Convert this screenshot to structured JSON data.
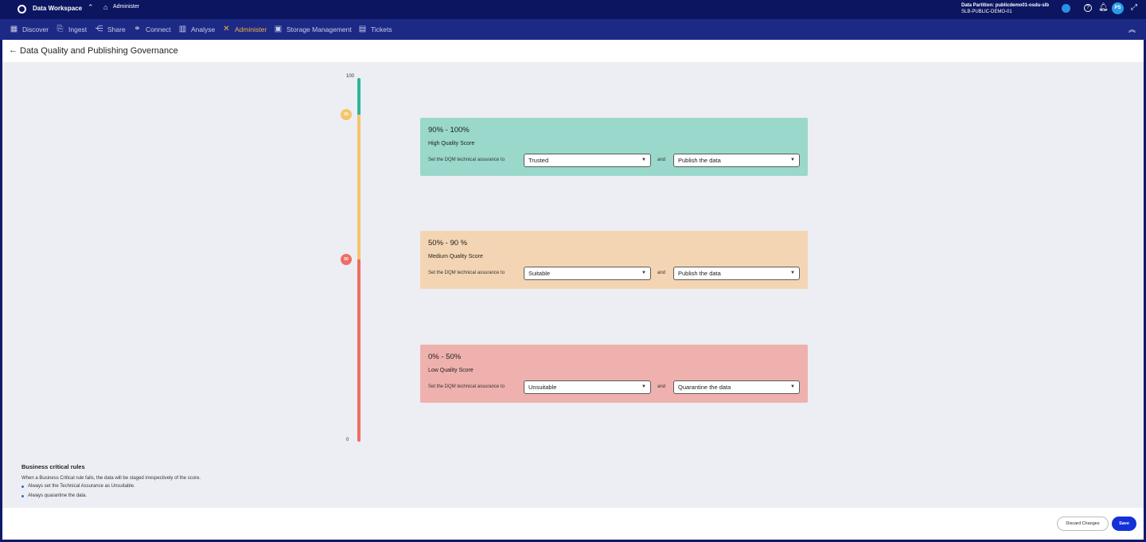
{
  "topbar": {
    "app_title": "Data Workspace",
    "breadcrumb": "Administer",
    "partition_label": "Data Partition: publicdemo01-osdu-slb",
    "partition_sub": "SLB-PUBLIC-DEMO-01",
    "avatar_initials": "PS",
    "help_glyph": "?"
  },
  "nav": {
    "items": [
      {
        "label": "Discover",
        "icon": "grid-icon"
      },
      {
        "label": "Ingest",
        "icon": "ingest-icon"
      },
      {
        "label": "Share",
        "icon": "share-icon"
      },
      {
        "label": "Connect",
        "icon": "connect-icon"
      },
      {
        "label": "Analyse",
        "icon": "analyse-icon"
      },
      {
        "label": "Administer",
        "icon": "administer-icon",
        "active": true
      },
      {
        "label": "Storage Management",
        "icon": "storage-icon"
      },
      {
        "label": "Tickets",
        "icon": "tickets-icon"
      }
    ],
    "active_color": "#f4b33c"
  },
  "page": {
    "title": "Data Quality and Publishing Governance"
  },
  "scale": {
    "top_label": "100",
    "bottom_label": "0",
    "marker_high": "90",
    "marker_med": "50",
    "colors": {
      "high": "#2db59a",
      "medium": "#f6c56a",
      "low": "#ef6d63"
    }
  },
  "cards": {
    "high": {
      "range": "90% - 100%",
      "label": "High Quality Score",
      "set_label": "Set the DQM technical assurance to",
      "assurance": "Trusted",
      "and": "and",
      "action": "Publish the data"
    },
    "medium": {
      "range": "50% - 90 %",
      "label": "Medium Quality Score",
      "set_label": "Set the DQM technical assurance to",
      "assurance": "Suitable",
      "and": "and",
      "action": "Publish the data"
    },
    "low": {
      "range": "0% - 50%",
      "label": "Low Quality Score",
      "set_label": "Set the DQM technical assurance to",
      "assurance": "Unsuitable",
      "and": "and",
      "action": "Quarantine the data"
    }
  },
  "rules": {
    "title": "Business critical rules",
    "description": "When a Business Critical rule fails, the data will be staged irrespectively of the score.",
    "items": [
      "Always set the Technical Assurance as Unsuitable.",
      "Always quarantine the data."
    ]
  },
  "footer": {
    "discard_label": "Discard Changes",
    "save_label": "Save",
    "save_color": "#1430d9"
  }
}
